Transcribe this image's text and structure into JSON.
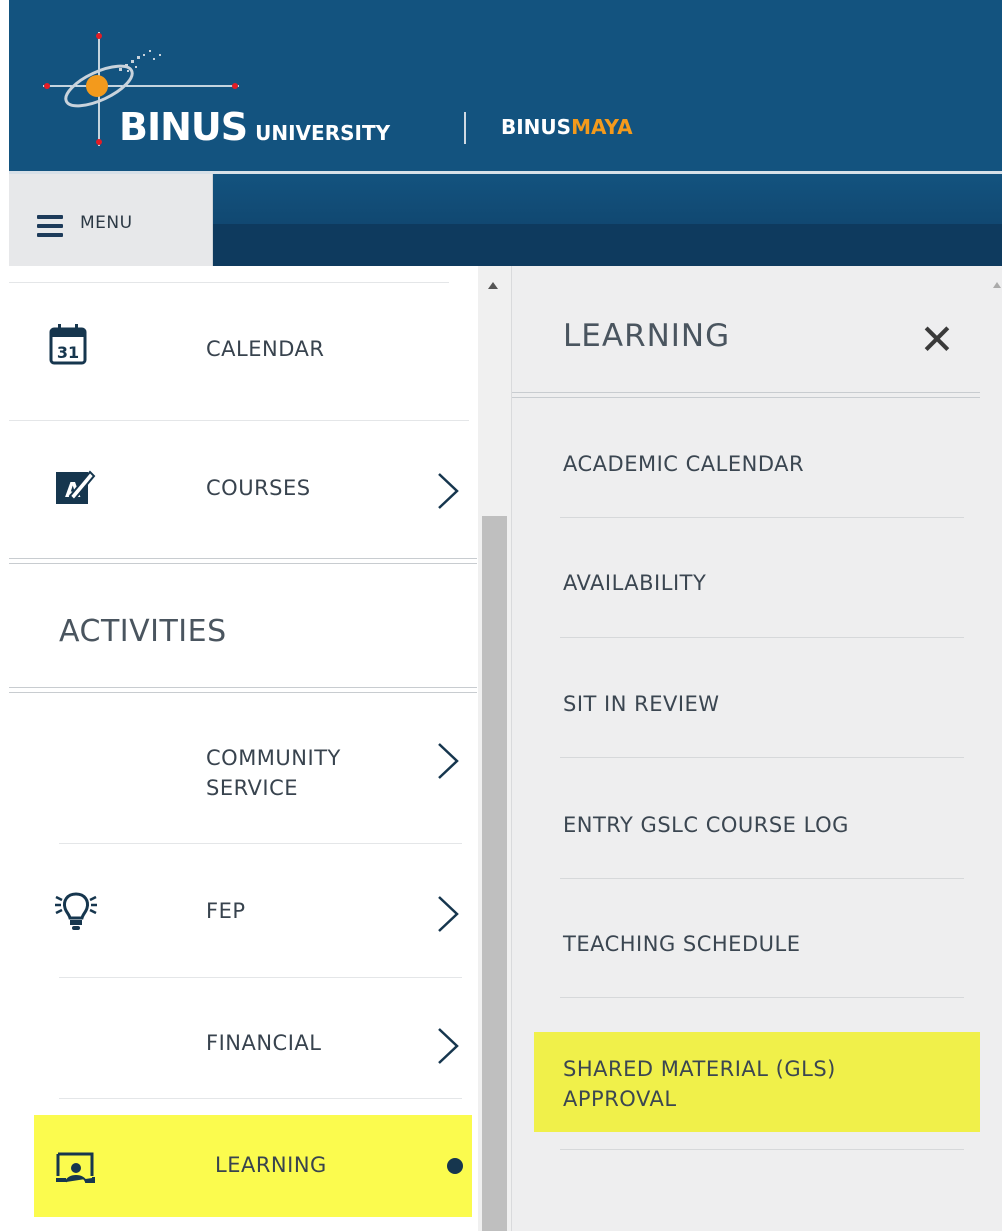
{
  "header": {
    "brand_main": "BINUS",
    "brand_university": "UNIVERSITY",
    "brand_maya_a": "BINUS",
    "brand_maya_b": "MAYA"
  },
  "menu": {
    "label": "MENU"
  },
  "left_panel": {
    "items_top": [
      {
        "label": "CALENDAR",
        "icon": "calendar-icon",
        "icon_text": "31"
      },
      {
        "label": "COURSES",
        "icon": "courses-icon"
      }
    ],
    "section_title": "ACTIVITIES",
    "items_activities": [
      {
        "label": "COMMUNITY\nSERVICE"
      },
      {
        "label": "FEP",
        "icon": "lightbulb-icon"
      },
      {
        "label": "FINANCIAL"
      },
      {
        "label": "LEARNING",
        "icon": "presentation-icon"
      }
    ]
  },
  "right_panel": {
    "title": "LEARNING",
    "close_symbol": "✕",
    "items": [
      {
        "label": "ACADEMIC CALENDAR"
      },
      {
        "label": "AVAILABILITY"
      },
      {
        "label": "SIT IN REVIEW"
      },
      {
        "label": "ENTRY GSLC COURSE LOG"
      },
      {
        "label": "TEACHING SCHEDULE"
      },
      {
        "label": "SHARED MATERIAL (GLS)\nAPPROVAL"
      }
    ]
  },
  "colors": {
    "header_bg": "#13537f",
    "highlight": "#fbfb4e",
    "accent_orange": "#f39a1c"
  }
}
